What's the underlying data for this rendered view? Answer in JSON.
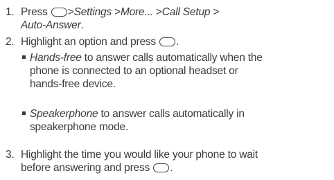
{
  "steps": [
    {
      "number": "1.",
      "press": "Press",
      "sep": ">",
      "path": [
        "Settings",
        "More...",
        "Call Setup",
        "Auto-Answer"
      ],
      "end": "."
    },
    {
      "number": "2.",
      "text_before": "Highlight an option and press",
      "end": "."
    },
    {
      "number": "3.",
      "text_line1": "Highlight the time you would like your phone to wait",
      "text_line2": "before answering and press",
      "end": "."
    }
  ],
  "options": [
    {
      "term": "Hands-free",
      "desc_line1": " to answer calls automatically when the",
      "desc_line2": "phone is connected to an optional headset or",
      "desc_line3": "hands-free device."
    },
    {
      "term": "Speakerphone",
      "desc_line1": " to answer calls automatically in",
      "desc_line2": "speakerphone mode."
    }
  ],
  "icons": {
    "menu_key": "oval-key-icon",
    "bullet": "square-bullet-icon"
  }
}
